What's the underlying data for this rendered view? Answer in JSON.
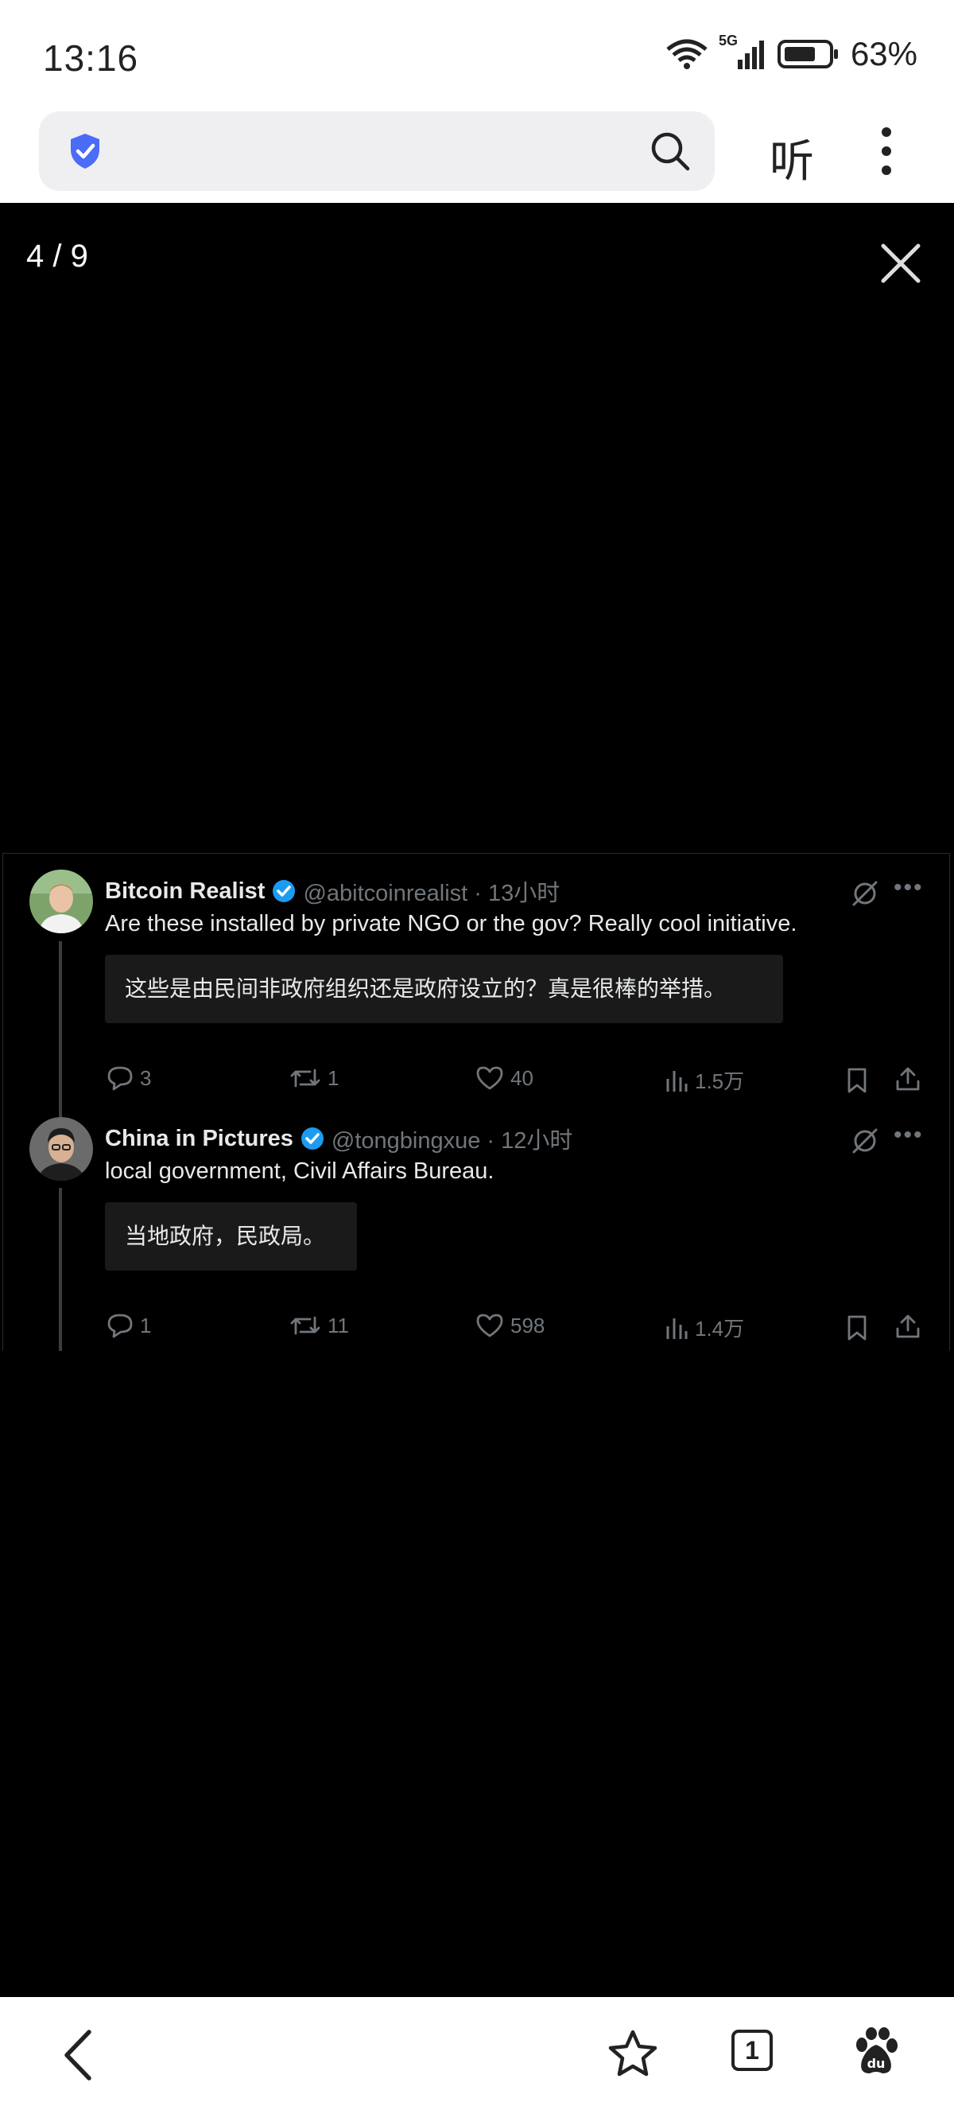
{
  "status": {
    "time": "13:16",
    "network": "5G",
    "battery": "63%"
  },
  "browser": {
    "listen_label": "听"
  },
  "viewer": {
    "counter": "4 / 9"
  },
  "tweets": [
    {
      "name": "Bitcoin Realist",
      "handle": "@abitcoinrealist · 13小时",
      "text": "Are these installed by private NGO or the gov? Really cool initiative.",
      "translation": "这些是由民间非政府组织还是政府设立的？真是很棒的举措。",
      "replies": "3",
      "reposts": "1",
      "likes": "40",
      "views": "1.5万"
    },
    {
      "name": "China in Pictures",
      "handle": "@tongbingxue · 12小时",
      "text": "local government, Civil Affairs Bureau.",
      "translation": "当地政府，民政局。",
      "replies": "1",
      "reposts": "11",
      "likes": "598",
      "views": "1.4万"
    }
  ],
  "bottom_nav": {
    "tab_count": "1"
  },
  "colors": {
    "verified": "#1d9bf0",
    "muted": "#71767b",
    "shield": "#4a6cf7"
  }
}
